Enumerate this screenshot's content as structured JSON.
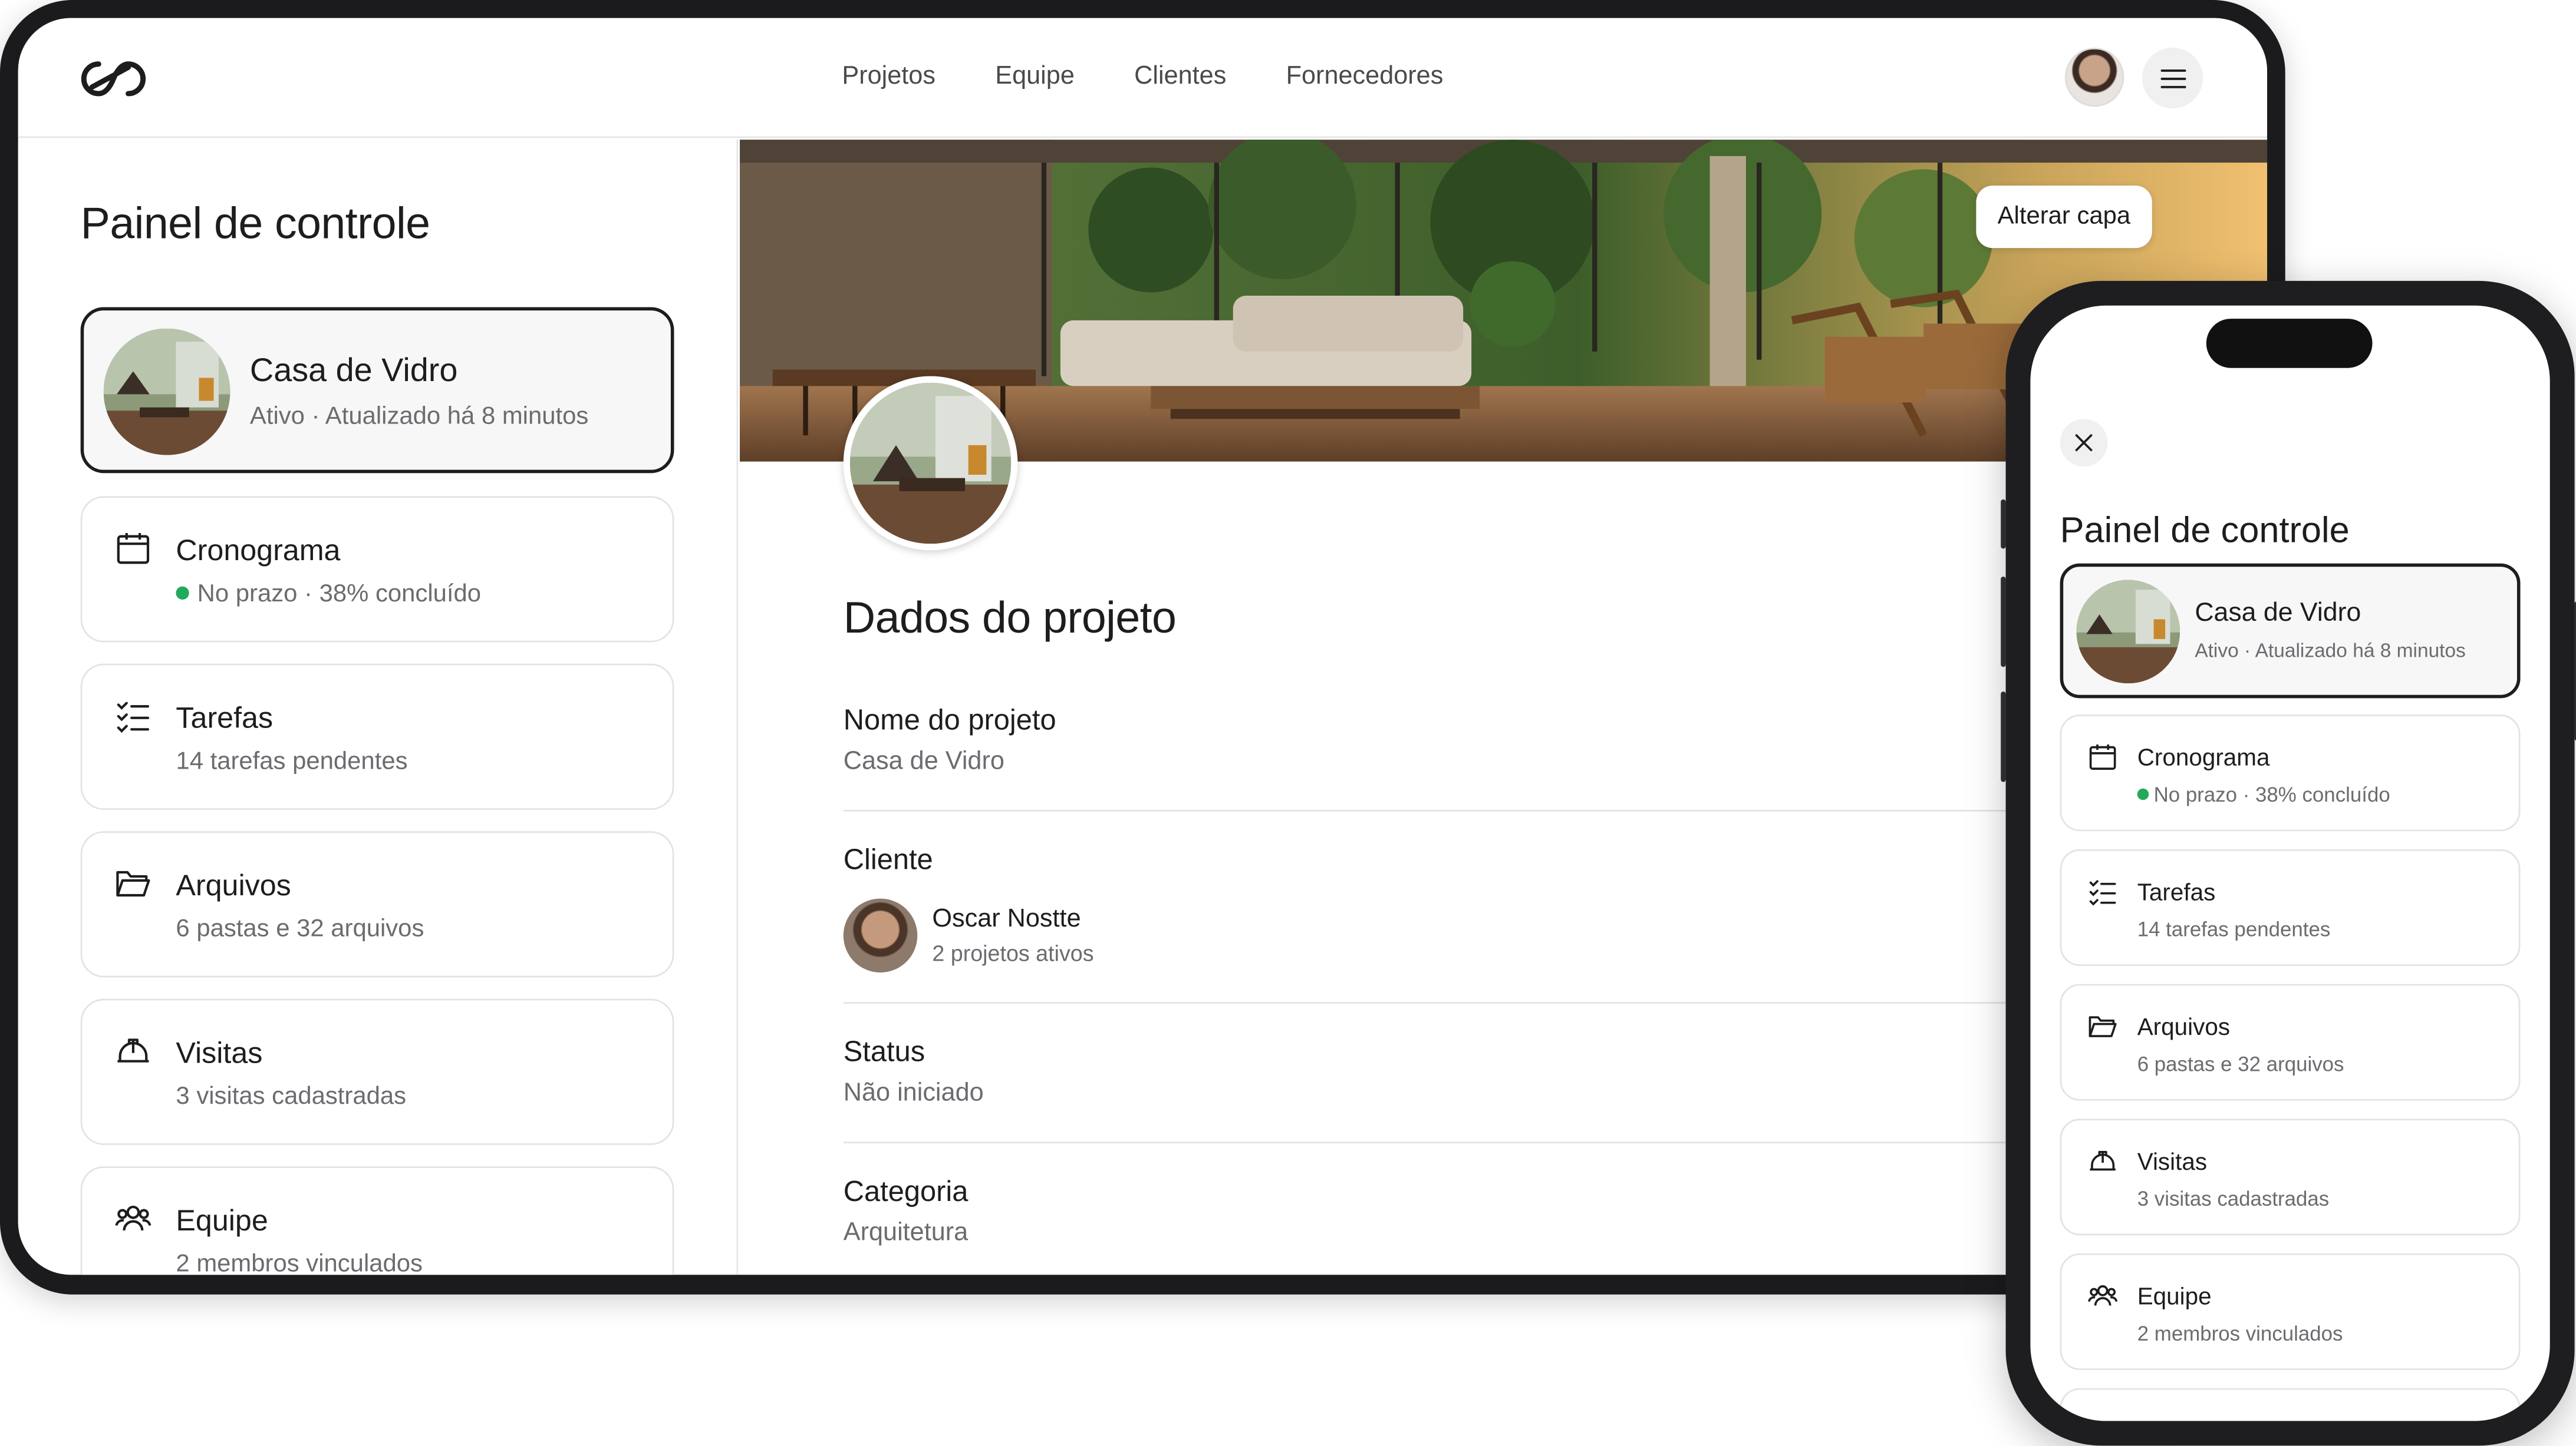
{
  "nav": {
    "items": [
      "Projetos",
      "Equipe",
      "Clientes",
      "Fornecedores"
    ]
  },
  "sidebar": {
    "title": "Painel de controle",
    "project": {
      "name": "Casa de Vidro",
      "status": "Ativo · Atualizado há 8 minutos"
    },
    "items": [
      {
        "title": "Cronograma",
        "sub": "No prazo · 38% concluído",
        "icon": "calendar-icon"
      },
      {
        "title": "Tarefas",
        "sub": "14 tarefas pendentes",
        "icon": "checklist-icon"
      },
      {
        "title": "Arquivos",
        "sub": "6 pastas e 32 arquivos",
        "icon": "folder-icon"
      },
      {
        "title": "Visitas",
        "sub": "3 visitas cadastradas",
        "icon": "hardhat-icon"
      },
      {
        "title": "Equipe",
        "sub": "2 membros vinculados",
        "icon": "team-icon"
      }
    ]
  },
  "main": {
    "cover_button": "Alterar capa",
    "heading": "Dados do projeto",
    "fields": {
      "name_label": "Nome do projeto",
      "name_value": "Casa de Vidro",
      "client_label": "Cliente",
      "client_name": "Oscar Nostte",
      "client_sub": "2 projetos ativos",
      "status_label": "Status",
      "status_value": "Não iniciado",
      "category_label": "Categoria",
      "category_value": "Arquitetura"
    }
  },
  "phone": {
    "title": "Painel de controle",
    "project": {
      "name": "Casa de Vidro",
      "status": "Ativo · Atualizado há 8 minutos"
    },
    "items": [
      {
        "title": "Cronograma",
        "sub": "No prazo · 38% concluído"
      },
      {
        "title": "Tarefas",
        "sub": "14 tarefas pendentes"
      },
      {
        "title": "Arquivos",
        "sub": "6 pastas e 32 arquivos"
      },
      {
        "title": "Visitas",
        "sub": "3 visitas cadastradas"
      },
      {
        "title": "Equipe",
        "sub": "2 membros vinculados"
      }
    ]
  },
  "colors": {
    "accent": "#1d1d1f",
    "status_ok": "#22a95a",
    "muted": "#6b6b70"
  }
}
